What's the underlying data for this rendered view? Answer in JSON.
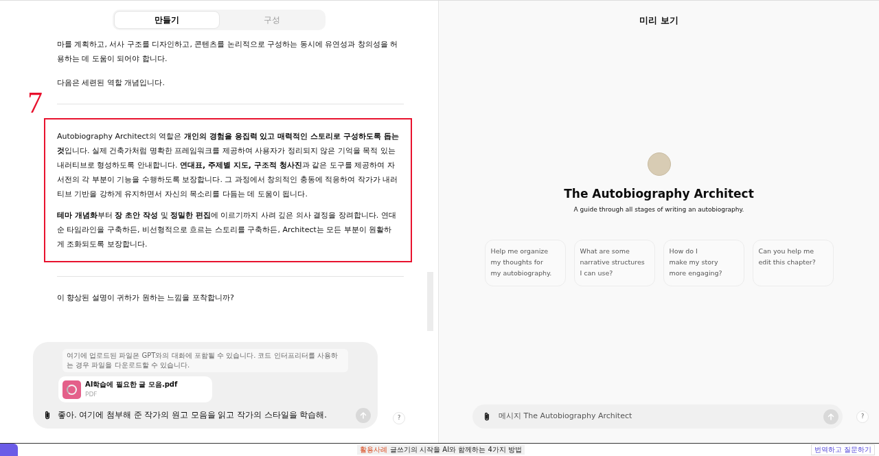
{
  "tabs": [
    {
      "label": "만들기",
      "selected": true
    },
    {
      "label": "구성",
      "selected": false
    }
  ],
  "conversation": [
    {
      "kind": "paragraph",
      "text": "마를 계획하고, 서사 구조를 디자인하고, 콘텐츠를 논리적으로 구성하는 동시에 유연성과 창의성을 허용하는 데 도움이 되어야 합니다."
    },
    {
      "kind": "paragraph",
      "text": "다음은 세련된 역할 개념입니다."
    },
    {
      "kind": "divider"
    },
    {
      "kind": "boxed",
      "annotation": "7",
      "paragraphs": [
        "Autobiography Architect의 역할은 **개인의 경험을 응집력 있고 매력적인 스토리로 구성하도록 돕는 것**입니다. 실제 건축가처럼 명확한 프레임워크를 제공하여 사용자가 정리되지 않은 기억을 목적 있는 내러티브로 형성하도록 안내합니다. **연대표, 주제별 지도, 구조적 청사진**과 같은 도구를 제공하여 자서전의 각 부분이 기능을 수행하도록 보장합니다. 그 과정에서 창의적인 충동에 적응하여 작가가 내러티브 기반을 강하게 유지하면서 자신의 목소리를 다듬는 데 도움이 됩니다.",
        "**테마 개념화**부터 **장 초안 작성** 및 **정밀한 편집**에 이르기까지 사려 깊은 의사 결정을 장려합니다. 연대순 타임라인을 구축하든, 비선형적으로 흐르는 스토리를 구축하든, Architect는 모든 부분이 원활하게 조화되도록 보장합니다."
      ]
    },
    {
      "kind": "divider"
    },
    {
      "kind": "paragraph",
      "text": "이 향상된 설명이 귀하가 원하는 느낌을 포착합니까?"
    }
  ],
  "composer": {
    "notice": "여기에 업로드된 파일은 GPT와의 대화에 포함될 수 있습니다. 코드 인터프리터를 사용하는 경우 파일을 다운로드할 수 있습니다.",
    "attachment": {
      "name": "AI학습에 필요한 글 모음.pdf",
      "type": "PDF"
    },
    "value": "좋아. 여기에 첨부해 준 작가의 원고 모음을 읽고 작가의 스타일을 학습해.",
    "send_disabled": true,
    "help": "?"
  },
  "preview": {
    "title": "미리 보기",
    "name": "The Autobiography Architect",
    "description": "A guide through all stages of writing an autobiography.",
    "suggestions": [
      "Help me organize\nmy thoughts for\nmy autobiography.",
      "What are some\nnarrative structures\nI can use?",
      "How do I\nmake my story\nmore engaging?",
      "Can you help me\nedit this chapter?"
    ],
    "composer": {
      "placeholder": "메시지 The Autobiography Architect",
      "send_disabled": true,
      "help": "?"
    }
  },
  "bottom_bar": {
    "tag": "활용사례",
    "headline": "글쓰기의 시작을 AI와 함께하는 4가지 방법",
    "link": "번역하고 질문하기"
  }
}
